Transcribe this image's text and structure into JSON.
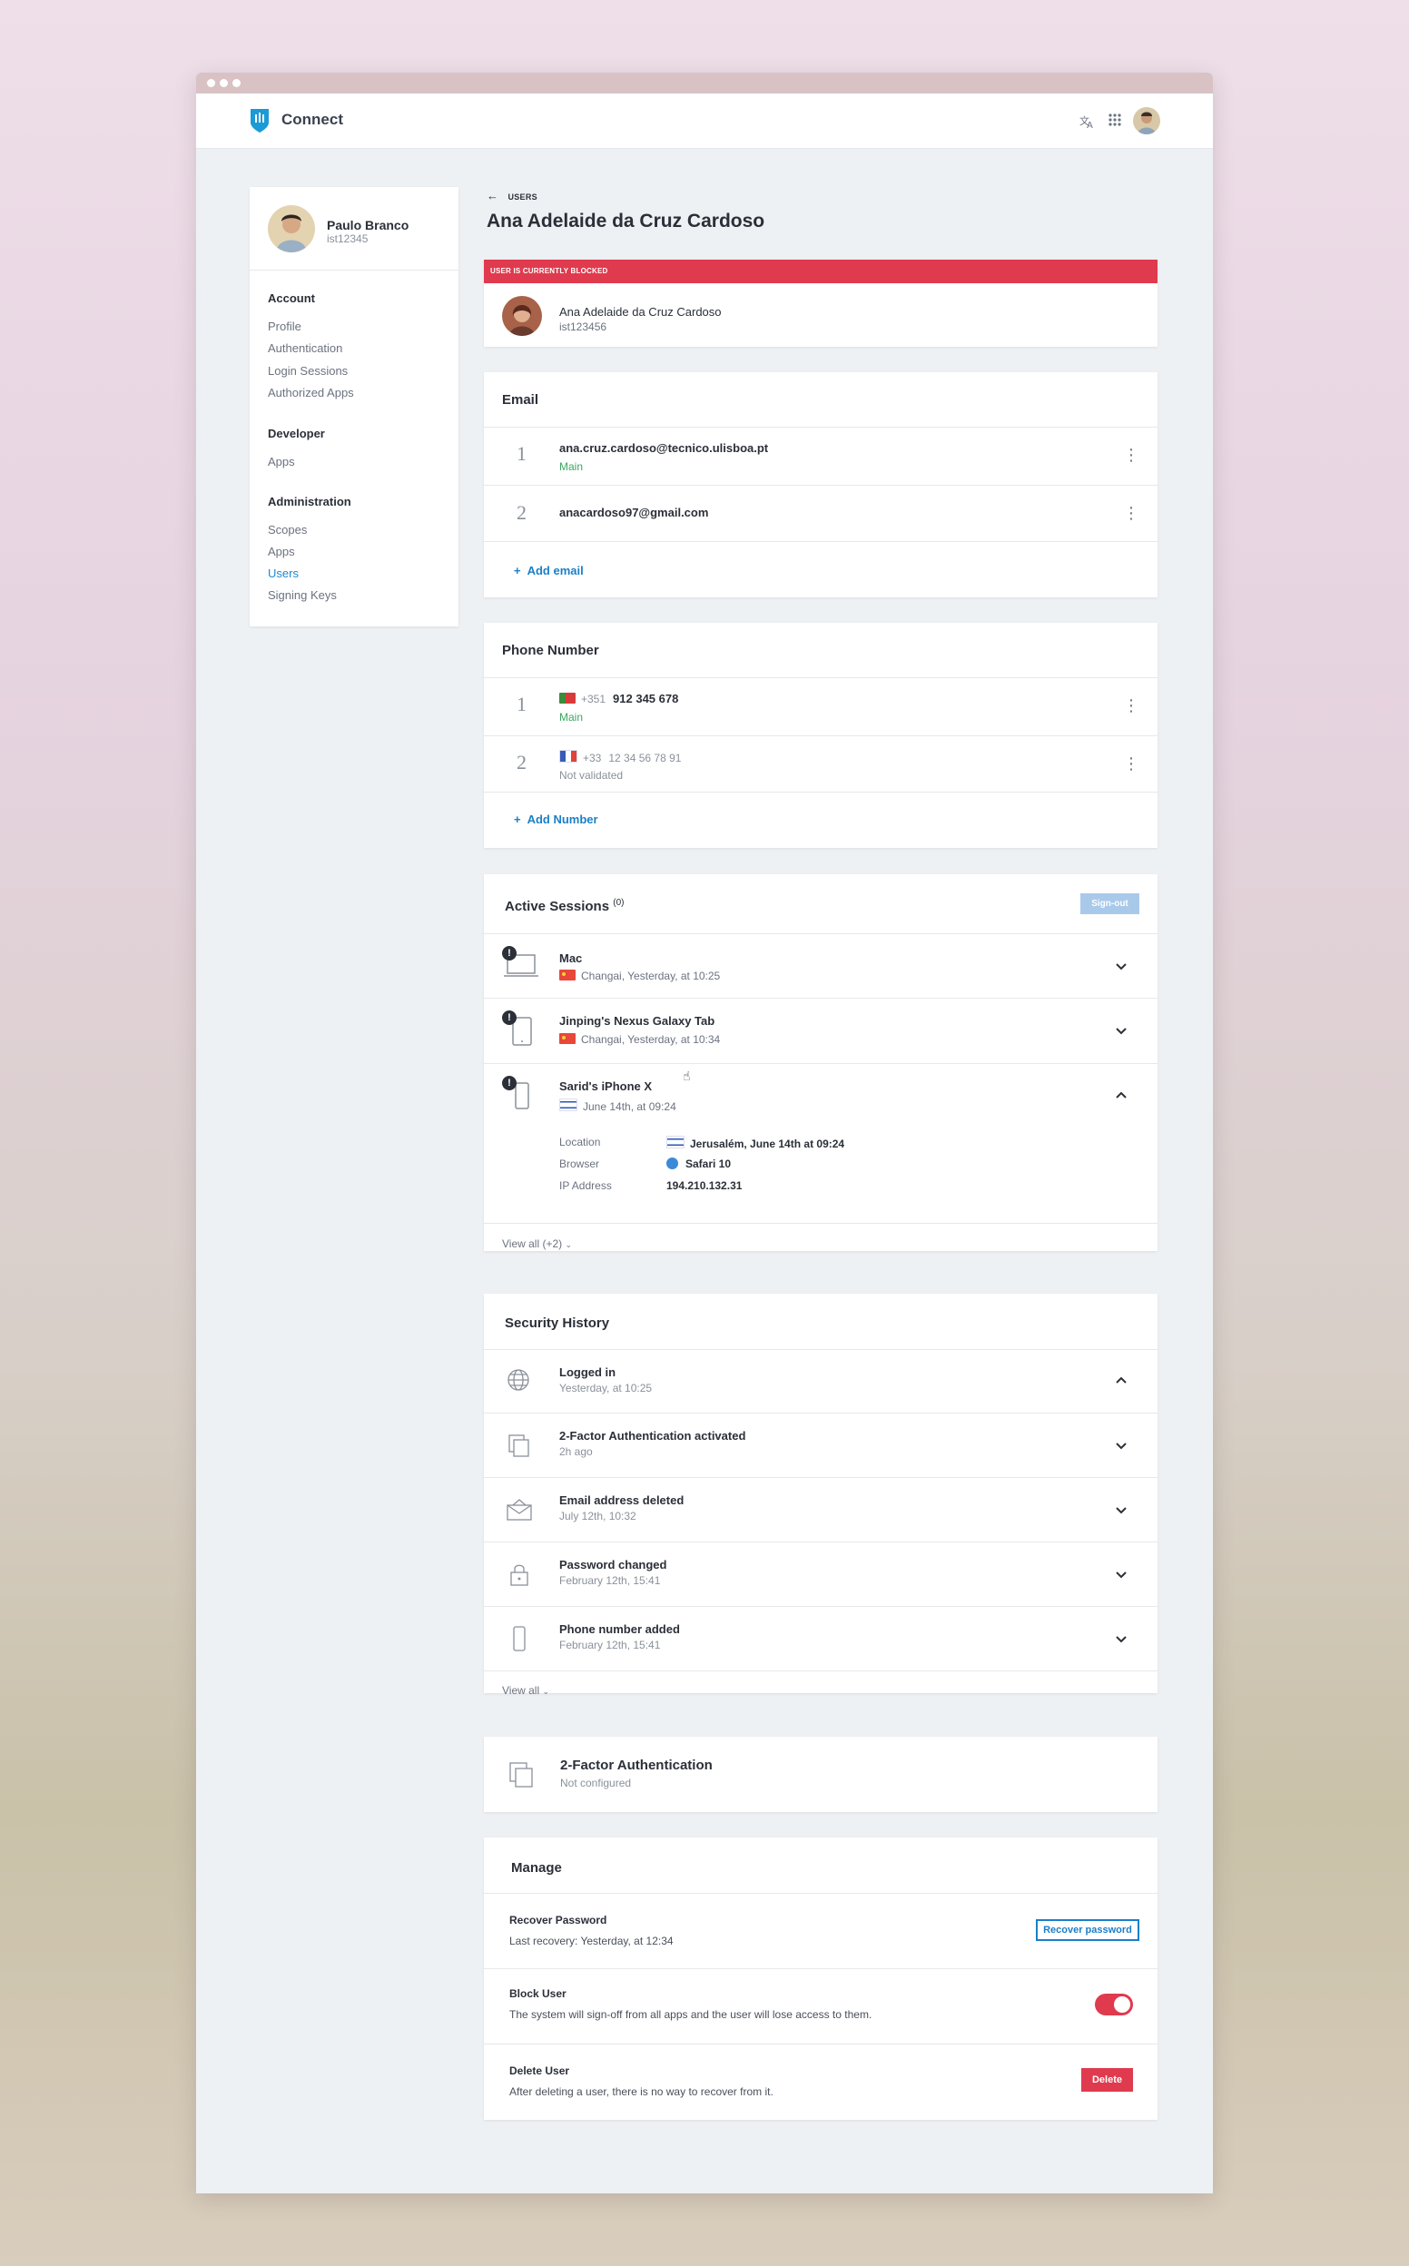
{
  "app": {
    "brand": "Connect"
  },
  "profile": {
    "name": "Paulo Branco",
    "id": "ist12345"
  },
  "sidebar": {
    "groups": [
      {
        "title": "Account",
        "items": [
          "Profile",
          "Authentication",
          "Login Sessions",
          "Authorized Apps"
        ]
      },
      {
        "title": "Developer",
        "items": [
          "Apps"
        ]
      },
      {
        "title": "Administration",
        "items": [
          "Scopes",
          "Apps",
          "Users",
          "Signing Keys"
        ]
      }
    ],
    "active": "Users"
  },
  "page": {
    "breadcrumb": "USERS",
    "title": "Ana Adelaide da Cruz Cardoso"
  },
  "user": {
    "banner": "USER IS CURRENTLY BLOCKED",
    "name": "Ana Adelaide da Cruz Cardoso",
    "id": "ist123456"
  },
  "email": {
    "title": "Email",
    "items": [
      {
        "num": "1",
        "address": "ana.cruz.cardoso@tecnico.ulisboa.pt",
        "tag": "Main"
      },
      {
        "num": "2",
        "address": "anacardoso97@gmail.com",
        "tag": ""
      }
    ],
    "add_label": "Add email"
  },
  "phone": {
    "title": "Phone Number",
    "items": [
      {
        "num": "1",
        "prefix": "+351",
        "number": "912 345 678",
        "status": "Main"
      },
      {
        "num": "2",
        "prefix": "+33",
        "number": "12 34 56 78 91",
        "status": "Not validated"
      }
    ],
    "add_label": "Add Number"
  },
  "sessions": {
    "title": "Active Sessions",
    "count": "(0)",
    "signout_label": "Sign-out",
    "items": [
      {
        "device": "Mac",
        "location": "Changai, Yesterday, at 10:25"
      },
      {
        "device": "Jinping's Nexus Galaxy Tab",
        "location": "Changai, Yesterday, at 10:34"
      },
      {
        "device": "Sarid's iPhone X",
        "location": "June 14th, at 09:24"
      }
    ],
    "details": {
      "location_label": "Location",
      "location_value": "Jerusalém, June 14th at 09:24",
      "browser_label": "Browser",
      "browser_value": "Safari 10",
      "ip_label": "IP Address",
      "ip_value": "194.210.132.31"
    },
    "view_all": "View all (+2)"
  },
  "history": {
    "title": "Security History",
    "items": [
      {
        "event": "Logged in",
        "time": "Yesterday, at 10:25"
      },
      {
        "event": "2-Factor Authentication activated",
        "time": "2h ago"
      },
      {
        "event": "Email address deleted",
        "time": "July 12th, 10:32"
      },
      {
        "event": "Password changed",
        "time": "February 12th, 15:41"
      },
      {
        "event": "Phone number added",
        "time": "February 12th, 15:41"
      }
    ],
    "view_all": "View all"
  },
  "twofa": {
    "title": "2-Factor Authentication",
    "status": "Not configured"
  },
  "manage": {
    "title": "Manage",
    "recover": {
      "title": "Recover Password",
      "desc": "Last recovery: Yesterday, at 12:34",
      "button": "Recover password"
    },
    "block": {
      "title": "Block User",
      "desc": "The system will sign-off from all apps and the user will lose access to them.",
      "enabled": true
    },
    "delete": {
      "title": "Delete User",
      "desc": "After deleting a user, there is no way to recover from it.",
      "button": "Delete"
    }
  },
  "colors": {
    "accent": "#1a7fc8",
    "danger": "#e03a4e",
    "success": "#3aa860"
  }
}
